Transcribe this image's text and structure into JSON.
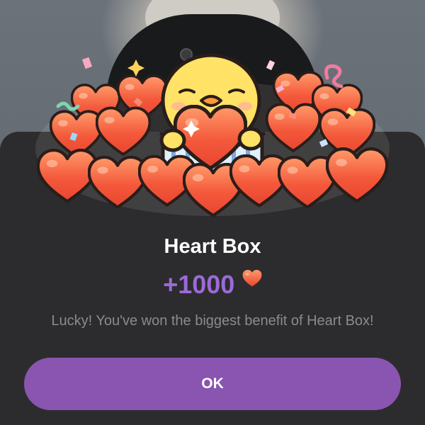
{
  "dialog": {
    "title": "Heart Box",
    "reward_amount": "+1000",
    "reward_icon": "heart-icon",
    "message": "Lucky! You've won the biggest benefit of Heart Box!",
    "ok_label": "OK"
  },
  "colors": {
    "sheet_background": "#2c2c2e",
    "accent_purple": "#9b6bd6",
    "button_background": "#8955b0",
    "heart_red": "#f0563a",
    "message_gray": "#8b8b8f"
  }
}
